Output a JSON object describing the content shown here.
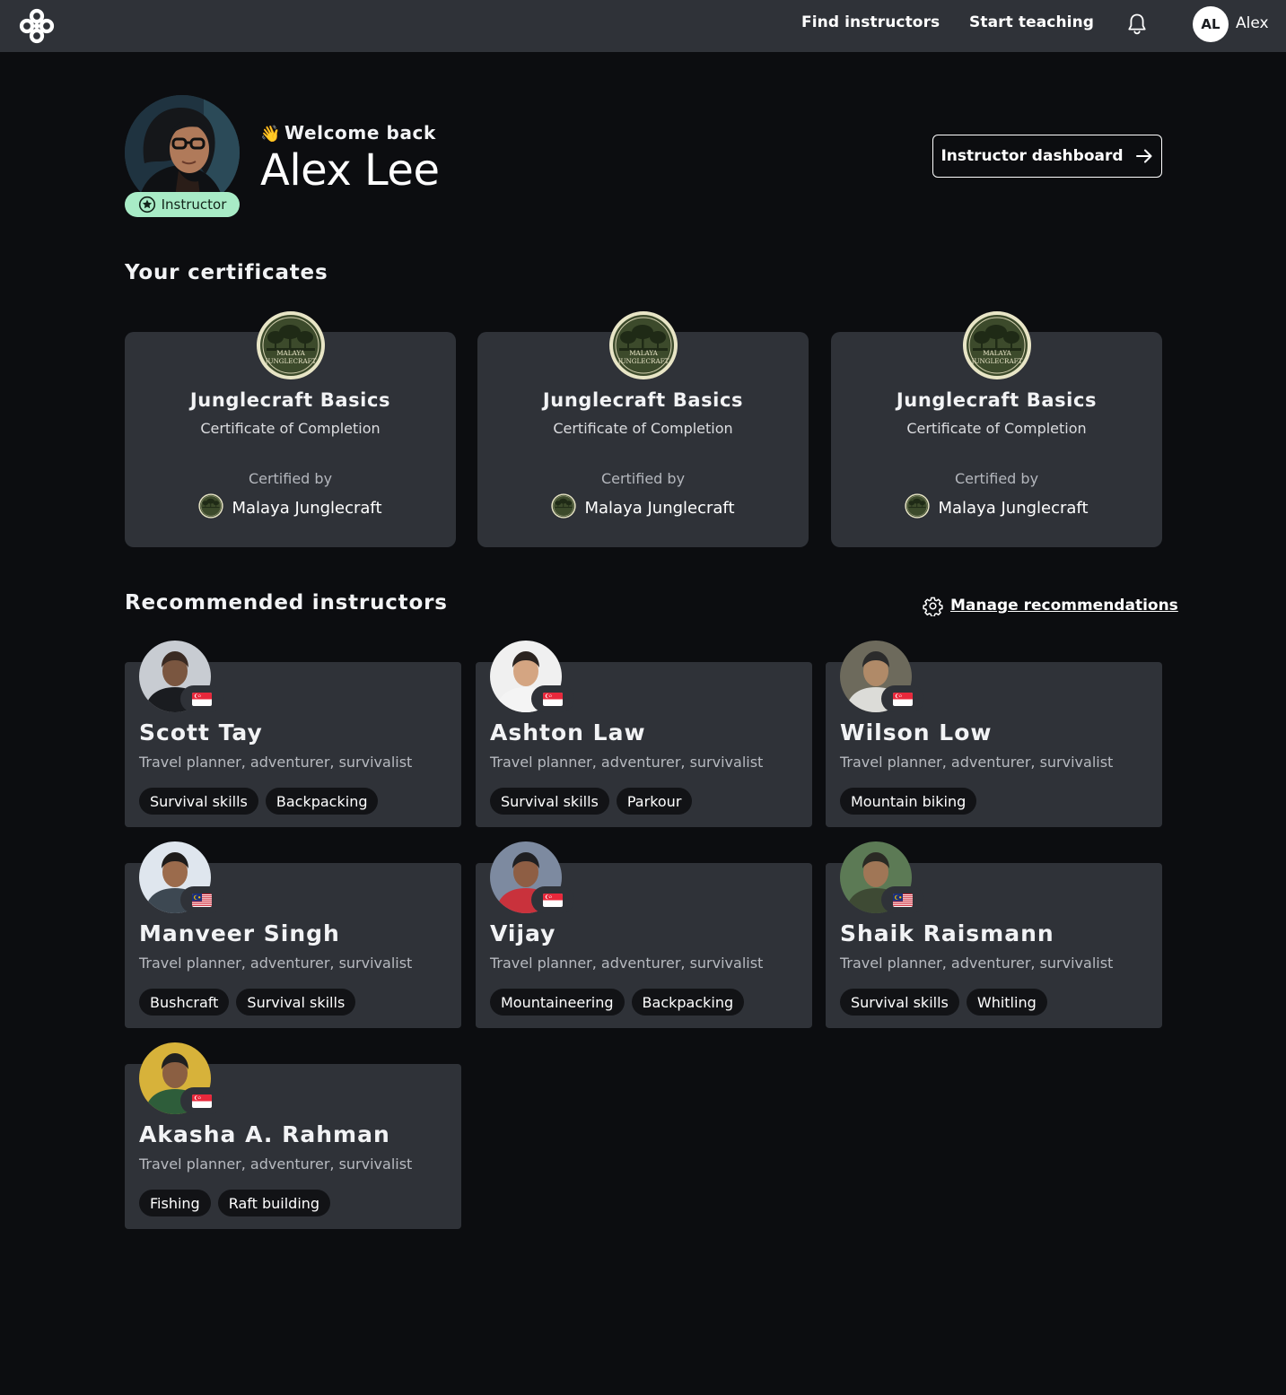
{
  "nav": {
    "find_instructors": "Find instructors",
    "start_teaching": "Start teaching",
    "user_initials": "AL",
    "user_name": "Alex"
  },
  "profile": {
    "welcome": "Welcome back",
    "wave_emoji": "👋",
    "full_name": "Alex Lee",
    "role_badge": "Instructor",
    "dashboard_button": "Instructor dashboard"
  },
  "certificates": {
    "title": "Your certificates",
    "items": [
      {
        "title": "Junglecraft Basics",
        "subtitle": "Certificate of Completion",
        "certified_by_label": "Certified by",
        "org": "Malaya Junglecraft",
        "seal_text": [
          "MALAYA",
          "JUNGLECRAFT"
        ]
      },
      {
        "title": "Junglecraft Basics",
        "subtitle": "Certificate of Completion",
        "certified_by_label": "Certified by",
        "org": "Malaya Junglecraft",
        "seal_text": [
          "MALAYA",
          "JUNGLECRAFT"
        ]
      },
      {
        "title": "Junglecraft Basics",
        "subtitle": "Certificate of Completion",
        "certified_by_label": "Certified by",
        "org": "Malaya Junglecraft",
        "seal_text": [
          "MALAYA",
          "JUNGLECRAFT"
        ]
      }
    ]
  },
  "recommended": {
    "title": "Recommended instructors",
    "manage_link": "Manage recommendations",
    "instructors": [
      {
        "name": "Scott Tay",
        "role": "Travel planner, adventurer, survivalist",
        "flag": "singapore-flag",
        "tags": [
          "Survival skills",
          "Backpacking"
        ]
      },
      {
        "name": "Ashton Law",
        "role": "Travel planner, adventurer, survivalist",
        "flag": "singapore-flag",
        "tags": [
          "Survival skills",
          "Parkour"
        ]
      },
      {
        "name": "Wilson Low",
        "role": "Travel planner, adventurer, survivalist",
        "flag": "singapore-flag",
        "tags": [
          "Mountain biking"
        ]
      },
      {
        "name": "Manveer Singh",
        "role": "Travel planner, adventurer, survivalist",
        "flag": "malaysia-flag",
        "tags": [
          "Bushcraft",
          "Survival skills"
        ]
      },
      {
        "name": "Vijay",
        "role": "Travel planner, adventurer, survivalist",
        "flag": "singapore-flag",
        "tags": [
          "Mountaineering",
          "Backpacking"
        ]
      },
      {
        "name": "Shaik Raismann",
        "role": "Travel planner, adventurer, survivalist",
        "flag": "malaysia-flag",
        "tags": [
          "Survival skills",
          "Whitling"
        ]
      },
      {
        "name": "Akasha A. Rahman",
        "role": "Travel planner, adventurer, survivalist",
        "flag": "singapore-flag",
        "tags": [
          "Fishing",
          "Raft building"
        ]
      }
    ]
  },
  "colors": {
    "page_bg": "#0c0d10",
    "surface": "#2f3238",
    "badge_green": "#a8ebc6",
    "tag_bg": "#121316"
  }
}
